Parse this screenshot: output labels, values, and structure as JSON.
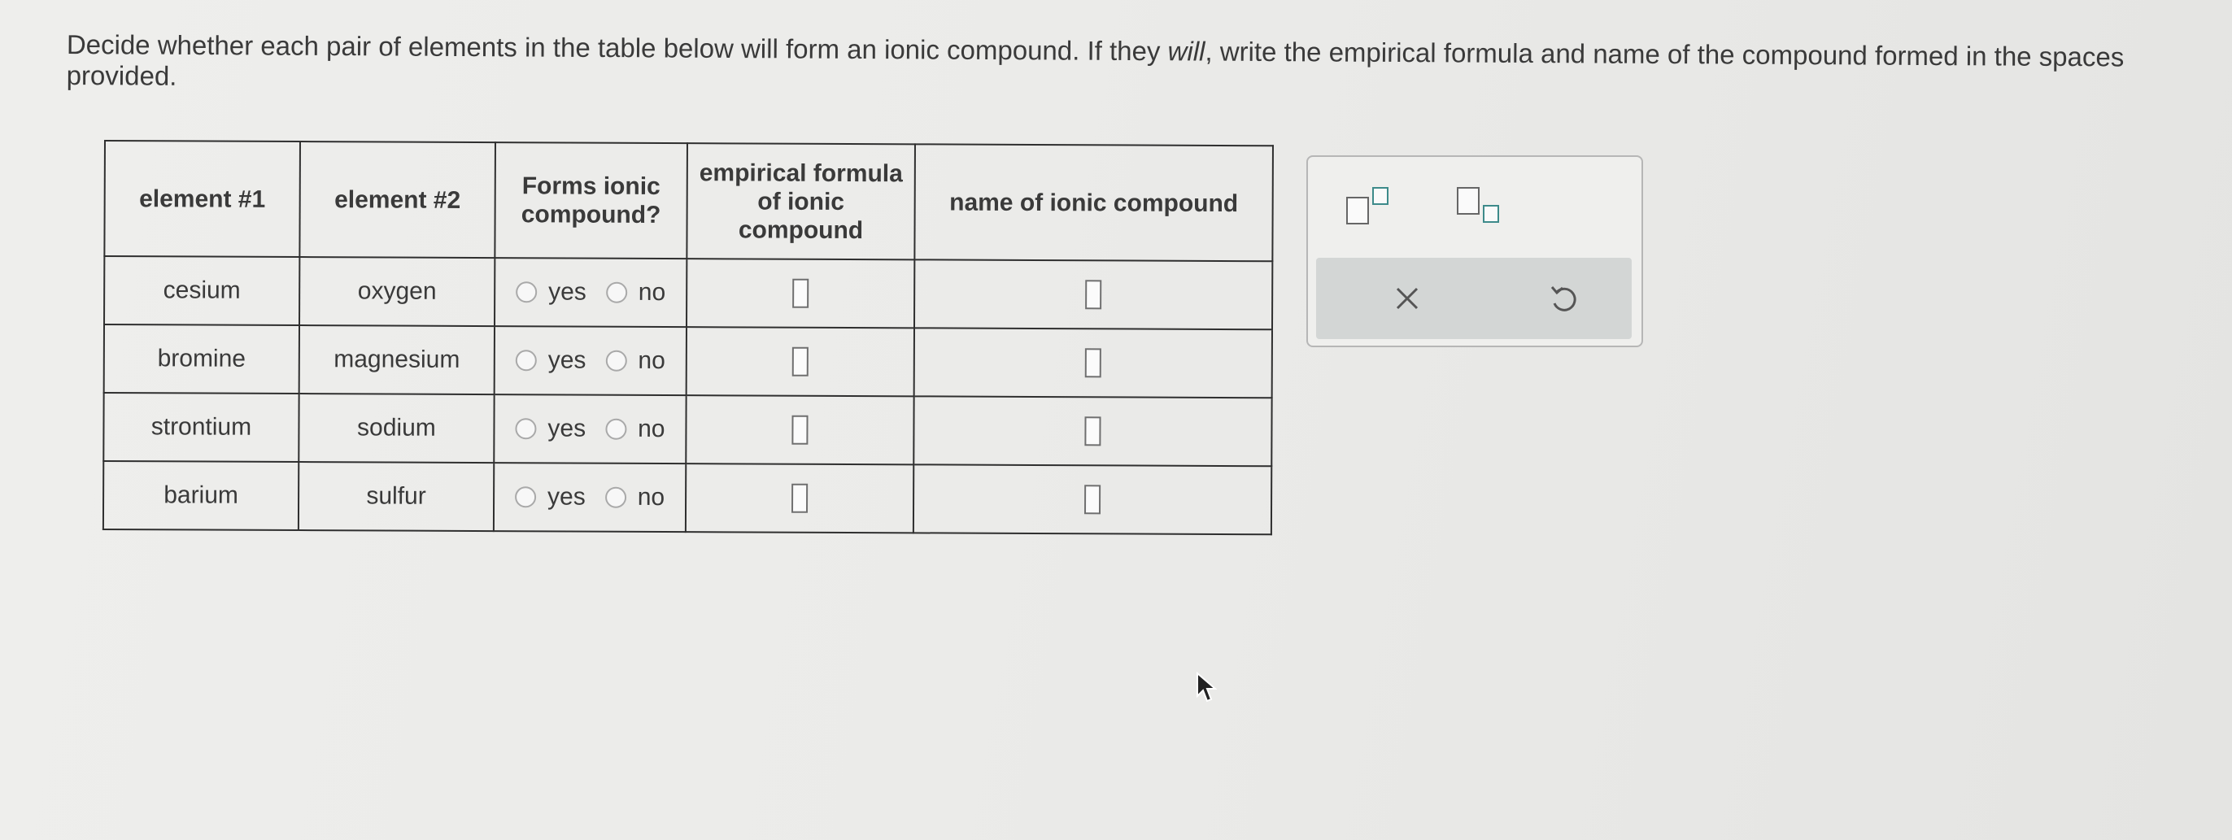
{
  "instructions": {
    "part1": "Decide whether each pair of elements in the table below will form an ionic compound. If they ",
    "emphasis": "will",
    "part2": ", write the empirical formula and name of the compound formed in the spaces provided."
  },
  "table": {
    "headers": {
      "element1": "element #1",
      "element2": "element #2",
      "forms_ionic": "Forms ionic compound?",
      "empirical_formula": "empirical formula of ionic compound",
      "name": "name of ionic compound"
    },
    "radio_labels": {
      "yes": "yes",
      "no": "no"
    },
    "rows": [
      {
        "element1": "cesium",
        "element2": "oxygen"
      },
      {
        "element1": "bromine",
        "element2": "magnesium"
      },
      {
        "element1": "strontium",
        "element2": "sodium"
      },
      {
        "element1": "barium",
        "element2": "sulfur"
      }
    ]
  },
  "palette": {
    "tools": [
      "superscript-icon",
      "subscript-icon"
    ],
    "actions": [
      "clear-icon",
      "undo-icon"
    ]
  }
}
